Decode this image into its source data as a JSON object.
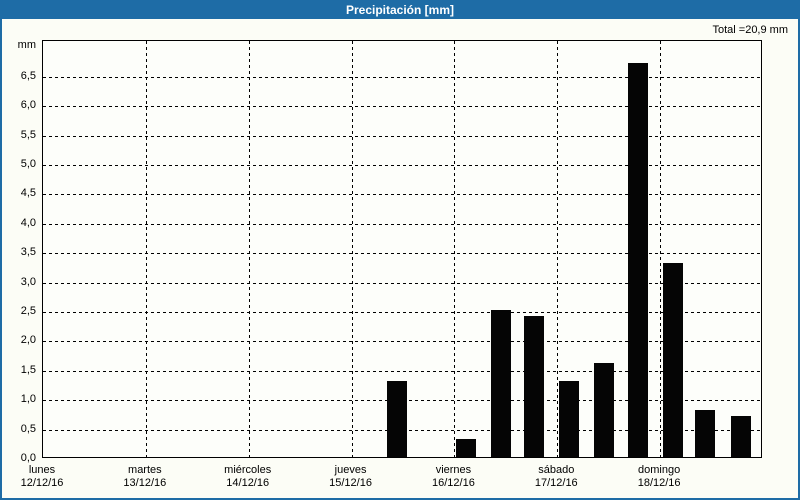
{
  "window": {
    "title": "Precipitación [mm]"
  },
  "summary": {
    "total_label": "Total =20,9 mm"
  },
  "colors": {
    "titlebar_blue": "#1e6ca6",
    "frame_blue": "#1e6ca6",
    "bar_black": "#050505",
    "background": "#fcfdf6",
    "grid_black": "#000000"
  },
  "chart_data": {
    "type": "bar",
    "title": "Precipitación [mm]",
    "ylabel": "mm",
    "xlabel": "",
    "ylim": [
      0,
      7.11
    ],
    "grid": true,
    "legend": "none",
    "total_mm": "20,9",
    "y_ticks": [
      {
        "value": 0,
        "label": "0,0"
      },
      {
        "value": 0.5,
        "label": "0,5"
      },
      {
        "value": 1,
        "label": "1,0"
      },
      {
        "value": 1.5,
        "label": "1,5"
      },
      {
        "value": 2,
        "label": "2,0"
      },
      {
        "value": 2.5,
        "label": "2,5"
      },
      {
        "value": 3,
        "label": "3,0"
      },
      {
        "value": 3.5,
        "label": "3,5"
      },
      {
        "value": 4,
        "label": "4,0"
      },
      {
        "value": 4.5,
        "label": "4,5"
      },
      {
        "value": 5,
        "label": "5,0"
      },
      {
        "value": 5.5,
        "label": "5,5"
      },
      {
        "value": 6,
        "label": "6,0"
      },
      {
        "value": 6.5,
        "label": "6,5"
      }
    ],
    "x_axis_days": [
      {
        "name": "lunes",
        "date": "12/12/16"
      },
      {
        "name": "martes",
        "date": "13/12/16"
      },
      {
        "name": "miércoles",
        "date": "14/12/16"
      },
      {
        "name": "jueves",
        "date": "15/12/16"
      },
      {
        "name": "viernes",
        "date": "16/12/16"
      },
      {
        "name": "sábado",
        "date": "17/12/16"
      },
      {
        "name": "domingo",
        "date": "18/12/16"
      }
    ],
    "bars": [
      {
        "x_frac": 0.492,
        "value": 1.3
      },
      {
        "x_frac": 0.587,
        "value": 0.3
      },
      {
        "x_frac": 0.636,
        "value": 2.5
      },
      {
        "x_frac": 0.682,
        "value": 2.4
      },
      {
        "x_frac": 0.73,
        "value": 1.3
      },
      {
        "x_frac": 0.779,
        "value": 1.6
      },
      {
        "x_frac": 0.826,
        "value": 6.7
      },
      {
        "x_frac": 0.875,
        "value": 3.3
      },
      {
        "x_frac": 0.92,
        "value": 0.8
      },
      {
        "x_frac": 0.969,
        "value": 0.7
      }
    ]
  }
}
